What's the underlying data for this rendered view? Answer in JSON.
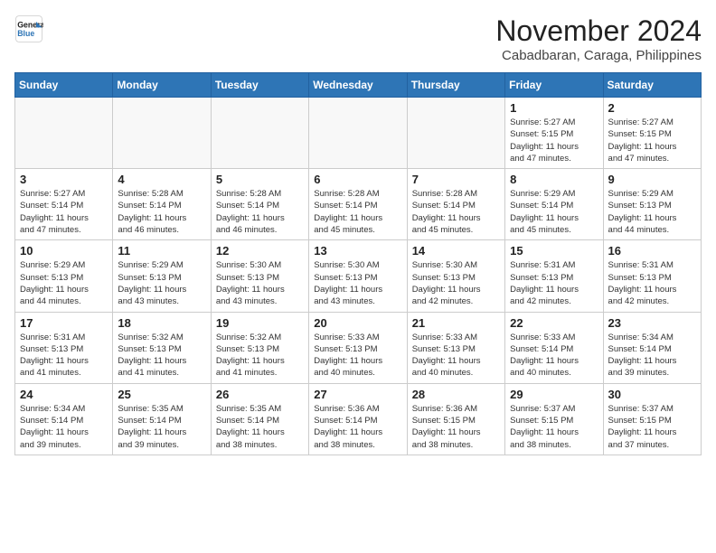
{
  "logo": {
    "line1": "General",
    "line2": "Blue",
    "arrow_color": "#2e75b6"
  },
  "title": "November 2024",
  "location": "Cabadbaran, Caraga, Philippines",
  "weekdays": [
    "Sunday",
    "Monday",
    "Tuesday",
    "Wednesday",
    "Thursday",
    "Friday",
    "Saturday"
  ],
  "weeks": [
    [
      {
        "day": "",
        "info": ""
      },
      {
        "day": "",
        "info": ""
      },
      {
        "day": "",
        "info": ""
      },
      {
        "day": "",
        "info": ""
      },
      {
        "day": "",
        "info": ""
      },
      {
        "day": "1",
        "info": "Sunrise: 5:27 AM\nSunset: 5:15 PM\nDaylight: 11 hours\nand 47 minutes."
      },
      {
        "day": "2",
        "info": "Sunrise: 5:27 AM\nSunset: 5:15 PM\nDaylight: 11 hours\nand 47 minutes."
      }
    ],
    [
      {
        "day": "3",
        "info": "Sunrise: 5:27 AM\nSunset: 5:14 PM\nDaylight: 11 hours\nand 47 minutes."
      },
      {
        "day": "4",
        "info": "Sunrise: 5:28 AM\nSunset: 5:14 PM\nDaylight: 11 hours\nand 46 minutes."
      },
      {
        "day": "5",
        "info": "Sunrise: 5:28 AM\nSunset: 5:14 PM\nDaylight: 11 hours\nand 46 minutes."
      },
      {
        "day": "6",
        "info": "Sunrise: 5:28 AM\nSunset: 5:14 PM\nDaylight: 11 hours\nand 45 minutes."
      },
      {
        "day": "7",
        "info": "Sunrise: 5:28 AM\nSunset: 5:14 PM\nDaylight: 11 hours\nand 45 minutes."
      },
      {
        "day": "8",
        "info": "Sunrise: 5:29 AM\nSunset: 5:14 PM\nDaylight: 11 hours\nand 45 minutes."
      },
      {
        "day": "9",
        "info": "Sunrise: 5:29 AM\nSunset: 5:13 PM\nDaylight: 11 hours\nand 44 minutes."
      }
    ],
    [
      {
        "day": "10",
        "info": "Sunrise: 5:29 AM\nSunset: 5:13 PM\nDaylight: 11 hours\nand 44 minutes."
      },
      {
        "day": "11",
        "info": "Sunrise: 5:29 AM\nSunset: 5:13 PM\nDaylight: 11 hours\nand 43 minutes."
      },
      {
        "day": "12",
        "info": "Sunrise: 5:30 AM\nSunset: 5:13 PM\nDaylight: 11 hours\nand 43 minutes."
      },
      {
        "day": "13",
        "info": "Sunrise: 5:30 AM\nSunset: 5:13 PM\nDaylight: 11 hours\nand 43 minutes."
      },
      {
        "day": "14",
        "info": "Sunrise: 5:30 AM\nSunset: 5:13 PM\nDaylight: 11 hours\nand 42 minutes."
      },
      {
        "day": "15",
        "info": "Sunrise: 5:31 AM\nSunset: 5:13 PM\nDaylight: 11 hours\nand 42 minutes."
      },
      {
        "day": "16",
        "info": "Sunrise: 5:31 AM\nSunset: 5:13 PM\nDaylight: 11 hours\nand 42 minutes."
      }
    ],
    [
      {
        "day": "17",
        "info": "Sunrise: 5:31 AM\nSunset: 5:13 PM\nDaylight: 11 hours\nand 41 minutes."
      },
      {
        "day": "18",
        "info": "Sunrise: 5:32 AM\nSunset: 5:13 PM\nDaylight: 11 hours\nand 41 minutes."
      },
      {
        "day": "19",
        "info": "Sunrise: 5:32 AM\nSunset: 5:13 PM\nDaylight: 11 hours\nand 41 minutes."
      },
      {
        "day": "20",
        "info": "Sunrise: 5:33 AM\nSunset: 5:13 PM\nDaylight: 11 hours\nand 40 minutes."
      },
      {
        "day": "21",
        "info": "Sunrise: 5:33 AM\nSunset: 5:13 PM\nDaylight: 11 hours\nand 40 minutes."
      },
      {
        "day": "22",
        "info": "Sunrise: 5:33 AM\nSunset: 5:14 PM\nDaylight: 11 hours\nand 40 minutes."
      },
      {
        "day": "23",
        "info": "Sunrise: 5:34 AM\nSunset: 5:14 PM\nDaylight: 11 hours\nand 39 minutes."
      }
    ],
    [
      {
        "day": "24",
        "info": "Sunrise: 5:34 AM\nSunset: 5:14 PM\nDaylight: 11 hours\nand 39 minutes."
      },
      {
        "day": "25",
        "info": "Sunrise: 5:35 AM\nSunset: 5:14 PM\nDaylight: 11 hours\nand 39 minutes."
      },
      {
        "day": "26",
        "info": "Sunrise: 5:35 AM\nSunset: 5:14 PM\nDaylight: 11 hours\nand 38 minutes."
      },
      {
        "day": "27",
        "info": "Sunrise: 5:36 AM\nSunset: 5:14 PM\nDaylight: 11 hours\nand 38 minutes."
      },
      {
        "day": "28",
        "info": "Sunrise: 5:36 AM\nSunset: 5:15 PM\nDaylight: 11 hours\nand 38 minutes."
      },
      {
        "day": "29",
        "info": "Sunrise: 5:37 AM\nSunset: 5:15 PM\nDaylight: 11 hours\nand 38 minutes."
      },
      {
        "day": "30",
        "info": "Sunrise: 5:37 AM\nSunset: 5:15 PM\nDaylight: 11 hours\nand 37 minutes."
      }
    ]
  ]
}
